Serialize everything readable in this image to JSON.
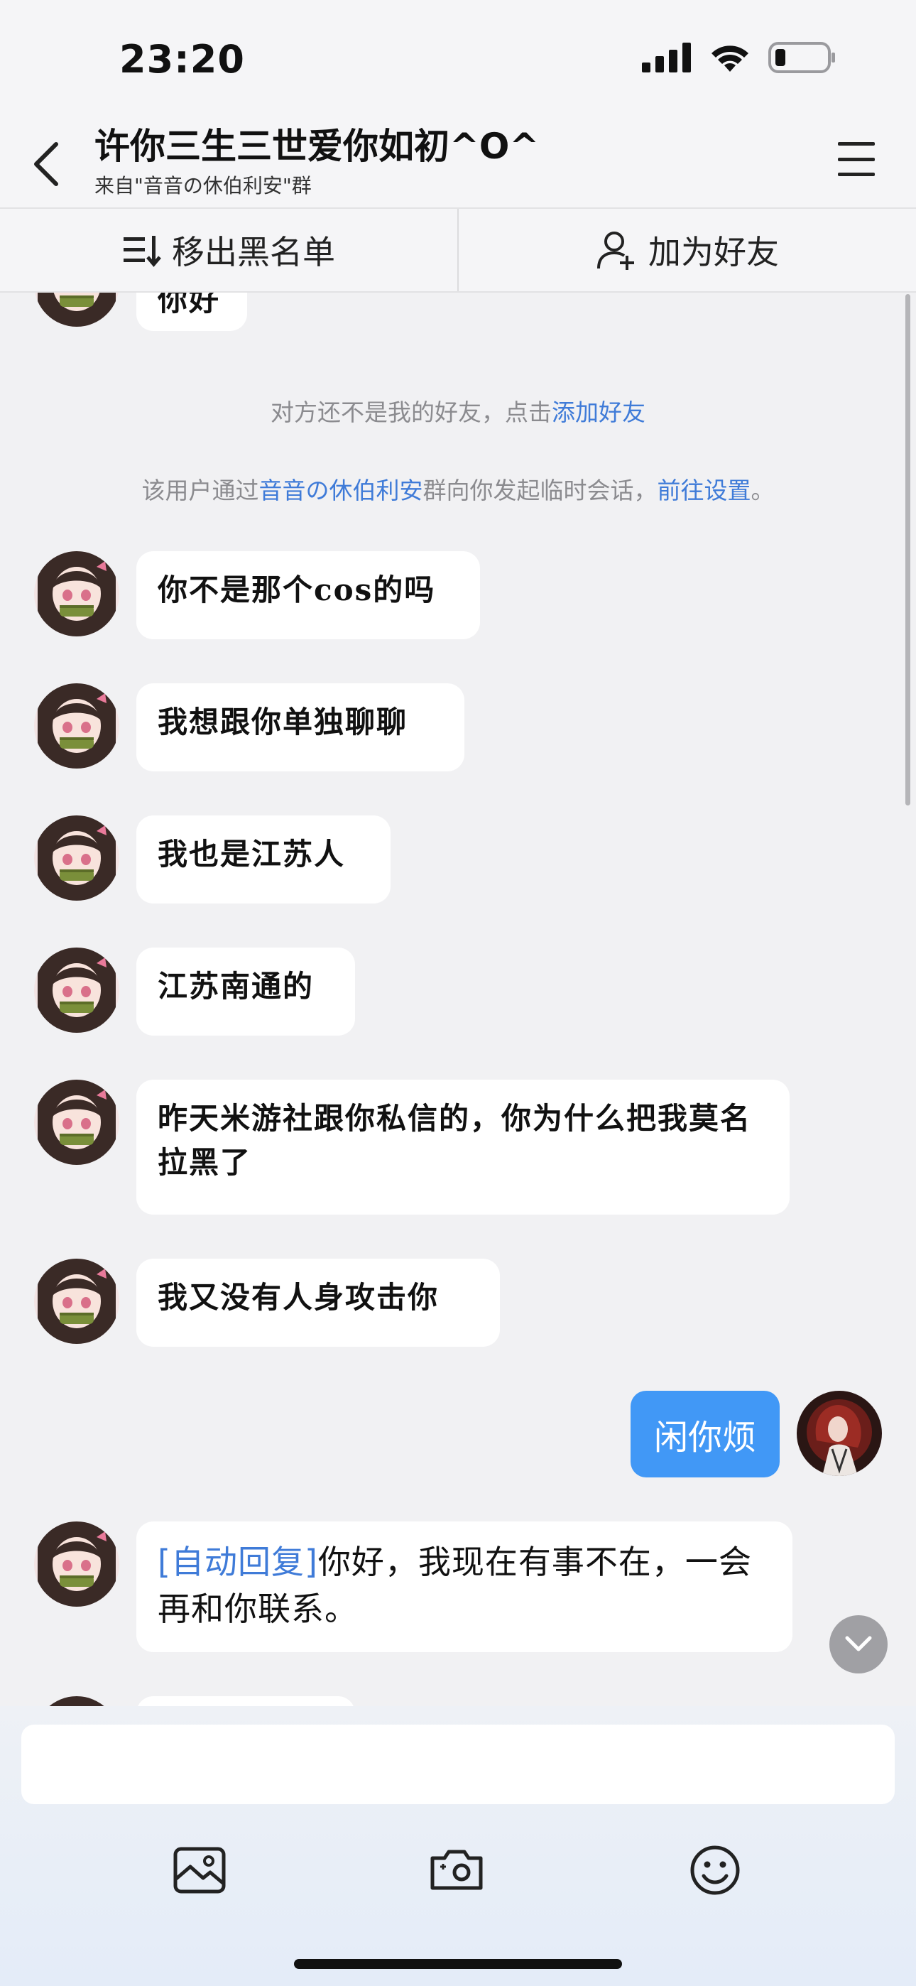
{
  "status_bar": {
    "time": "23:20"
  },
  "header": {
    "title": "许你三生三世爱你如初^O^",
    "subtitle": "来自\"音音の休伯利安\"群"
  },
  "actions": {
    "remove_blacklist": "移出黑名单",
    "add_friend": "加为好友"
  },
  "system_notices": {
    "not_friend_text": "对方还不是我的好友，点击",
    "not_friend_link": "添加好友",
    "temp_prefix": "该用户通过",
    "temp_group": "音音の休伯利安",
    "temp_middle": "群向你发起临时会话，",
    "temp_link": "前往设置",
    "temp_end": "。"
  },
  "messages": {
    "partial_top": "你好",
    "m1": "你不是那个cos的吗",
    "m2": "我想跟你单独聊聊",
    "m3": "我也是江苏人",
    "m4": "江苏南通的",
    "m5": "昨天米游社跟你私信的，你为什么把我莫名拉黑了",
    "m6": "我又没有人身攻击你",
    "mine": "闲你烦",
    "auto_tag": "[自动回复]",
    "auto_text": "你好，我现在有事不在，一会再和你联系。"
  },
  "icons": {
    "back": "back-chevron-icon",
    "menu": "hamburger-menu-icon",
    "blacklist": "list-remove-icon",
    "add_friend": "person-add-icon",
    "gallery": "image-icon",
    "camera": "camera-icon",
    "emoji": "emoji-icon",
    "scroll_down": "chevron-down-icon"
  },
  "colors": {
    "link": "#3f7bd8",
    "my_bubble": "#4198f6",
    "background": "#f1f1f3"
  }
}
